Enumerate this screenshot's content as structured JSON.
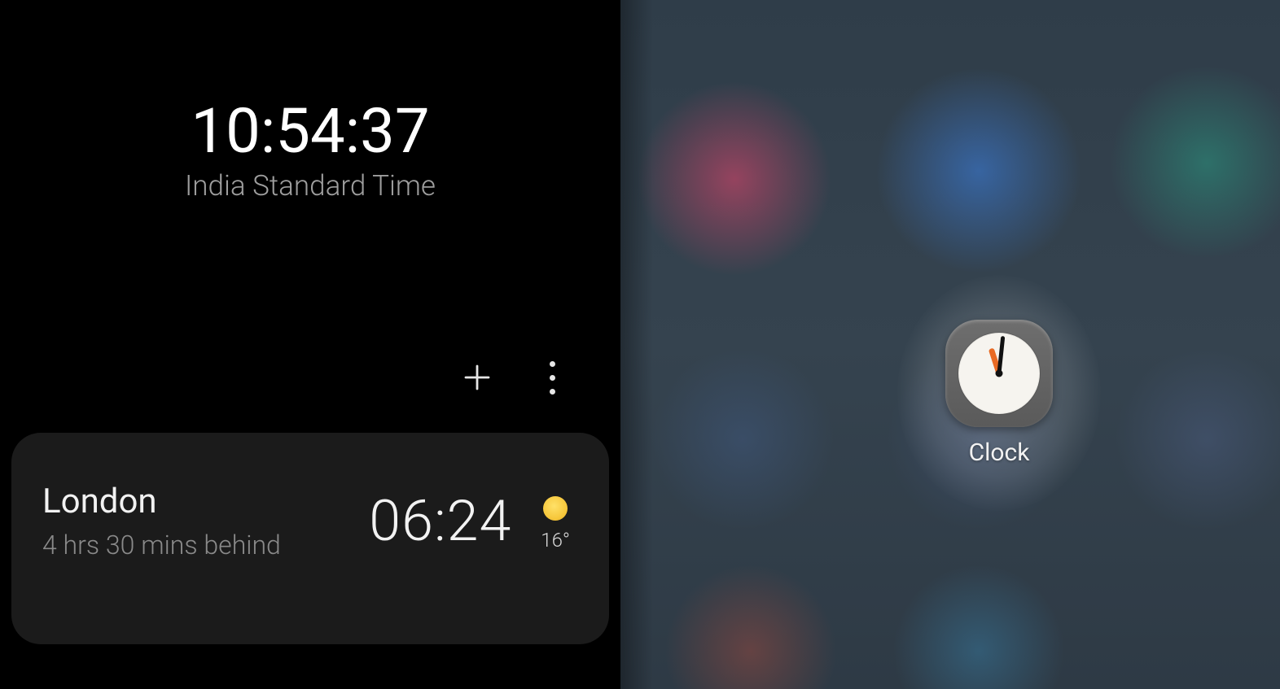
{
  "clockScreen": {
    "main_time": "10:54:37",
    "timezone_label": "India Standard Time",
    "cities": [
      {
        "name": "London",
        "offset": "4 hrs 30 mins behind",
        "time": "06:24",
        "weather_icon": "sun-icon",
        "temperature": "16°"
      }
    ]
  },
  "homeScreen": {
    "focused_app": {
      "label": "Clock",
      "icon": "clock-app-icon"
    }
  }
}
